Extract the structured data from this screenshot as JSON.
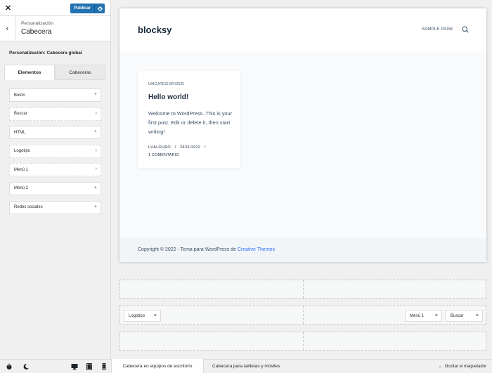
{
  "topbar": {
    "close_glyph": "✕",
    "publish_label": "Publicar",
    "publish_settings_icon": "gear-icon"
  },
  "section": {
    "back_glyph": "‹",
    "supertitle": "Personalización",
    "title": "Cabecera"
  },
  "panel_title": "Personalización: Cabecera global",
  "tabs": [
    {
      "label": "Elementos",
      "active": true
    },
    {
      "label": "Cabeceras",
      "active": false
    }
  ],
  "elements": [
    {
      "label": "Botón",
      "icon": "plus-icon",
      "glyph": "+"
    },
    {
      "label": "Buscar",
      "icon": "chevron-right-icon",
      "glyph": "›"
    },
    {
      "label": "HTML",
      "icon": "plus-icon",
      "glyph": "+"
    },
    {
      "label": "Logotipo",
      "icon": "chevron-right-icon",
      "glyph": "›"
    },
    {
      "label": "Menú 1",
      "icon": "chevron-right-icon",
      "glyph": "›"
    },
    {
      "label": "Menú 2",
      "icon": "plus-icon",
      "glyph": "+"
    },
    {
      "label": "Redes sociales",
      "icon": "plus-icon",
      "glyph": "+"
    }
  ],
  "sidebar_footer": {
    "icons": [
      "power-icon",
      "moon-icon",
      "desktop-icon",
      "tablet-icon",
      "mobile-icon"
    ]
  },
  "site": {
    "logo": "blocksy",
    "nav": [
      "SAMPLE PAGE"
    ],
    "search_icon": "search-icon",
    "post": {
      "category": "UNCATEGORIZED",
      "title": "Hello world!",
      "excerpt": "Welcome to WordPress. This is your first post. Edit or delete it, then start writing!",
      "author": "LUALOURO",
      "date": "24/11/2022",
      "comments": "1 COMENTARIO",
      "sep": "/"
    },
    "footer": {
      "copyright": "Copyright © 2022 - Tema para WordPress de",
      "link": "Creative Themes"
    }
  },
  "builder": {
    "middle_left": {
      "label": "Logotipo",
      "x": "×"
    },
    "middle_right": [
      {
        "label": "Menú 1",
        "x": "×"
      },
      {
        "label": "Buscar",
        "x": "×"
      }
    ]
  },
  "bottombar": {
    "tabs": [
      {
        "label": "Cabecera en equipos de escritorio",
        "active": true
      },
      {
        "label": "Cabecera para tabletas y móviles",
        "active": false
      }
    ],
    "hide_label": "Ocultar el maquetador",
    "hide_glyph": "⌄"
  },
  "colors": {
    "accent": "#2271b1",
    "link": "#2872fa",
    "heading": "#192a3d",
    "text": "#3a4f66"
  }
}
